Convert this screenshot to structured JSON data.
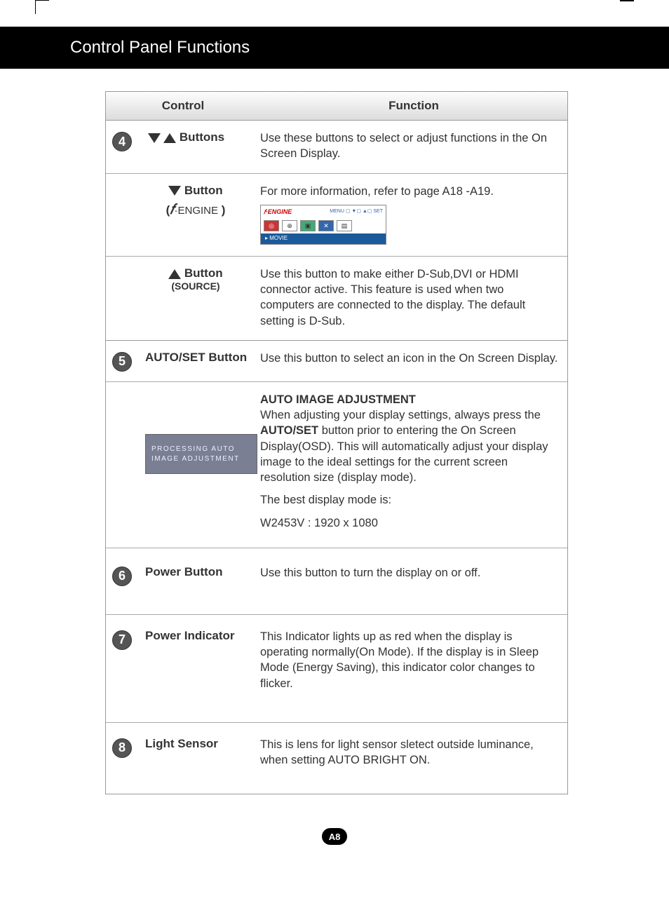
{
  "page_title": "Control Panel Functions",
  "page_number": "A8",
  "headers": {
    "control": "Control",
    "function": "Function"
  },
  "row4": {
    "badge": "4",
    "a": {
      "label": "Buttons",
      "desc": "Use these buttons to select or adjust functions in the On Screen Display."
    },
    "b": {
      "label": "Button",
      "sublabel_prefix": "(",
      "sublabel_engine": "ENGINE",
      "sublabel_suffix": " )",
      "desc": "For more information, refer to page A18 -A19.",
      "osd": {
        "fe": "𝑓·ENGINE",
        "menu": "MENU ▢ ▼▢ ▲▢ SET",
        "movie": "MOVIE"
      }
    },
    "c": {
      "label": "Button",
      "sublabel": "(SOURCE)",
      "desc": "Use this button to make either D-Sub,DVI or HDMI connector active. This feature is used when two computers are connected to the display. The default setting is D-Sub."
    }
  },
  "row5": {
    "badge": "5",
    "label": "AUTO/SET Button",
    "desc": "Use this button to select an icon in the On Screen Display.",
    "osd_line1": "PROCESSING AUTO",
    "osd_line2": "IMAGE ADJUSTMENT",
    "block_title": "AUTO IMAGE ADJUSTMENT",
    "block_text1": "When adjusting your display settings, always press the ",
    "block_bold": "AUTO/SET",
    "block_text2": " button prior to entering the On Screen Display(OSD). This will automatically adjust your display image to the ideal settings for the current screen resolution size (display mode).",
    "block_text3": "The best display mode is:",
    "block_text4": "W2453V : 1920 x 1080"
  },
  "row6": {
    "badge": "6",
    "label": "Power Button",
    "desc": "Use this button to turn the display on or off."
  },
  "row7": {
    "badge": "7",
    "label": "Power Indicator",
    "desc": "This Indicator lights up as red when the display is operating normally(On Mode). If the display is in Sleep Mode (Energy Saving), this indicator color changes to flicker."
  },
  "row8": {
    "badge": "8",
    "label": "Light Sensor",
    "desc": "This is lens for light sensor sletect outside luminance, when setting AUTO BRIGHT ON."
  }
}
